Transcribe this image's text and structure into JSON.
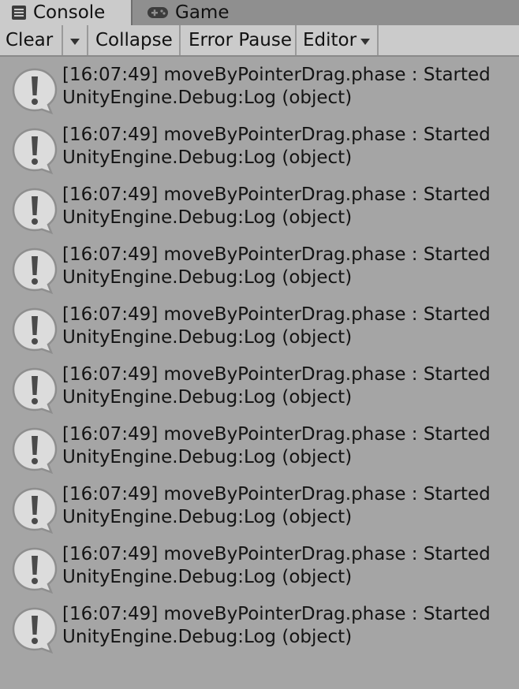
{
  "tabs": [
    {
      "label": "Console",
      "icon": "console-icon",
      "active": true
    },
    {
      "label": "Game",
      "icon": "gamepad-icon",
      "active": false
    }
  ],
  "toolbar": {
    "clear_label": "Clear",
    "clear_dropdown_icon": "chevron-down-icon",
    "collapse_label": "Collapse",
    "error_pause_label": "Error Pause",
    "editor_label": "Editor",
    "editor_dropdown_icon": "chevron-down-icon"
  },
  "logs": [
    {
      "icon": "info-message-icon",
      "message": "[16:07:49] moveByPointerDrag.phase : Started",
      "source": "UnityEngine.Debug:Log (object)"
    },
    {
      "icon": "info-message-icon",
      "message": "[16:07:49] moveByPointerDrag.phase : Started",
      "source": "UnityEngine.Debug:Log (object)"
    },
    {
      "icon": "info-message-icon",
      "message": "[16:07:49] moveByPointerDrag.phase : Started",
      "source": "UnityEngine.Debug:Log (object)"
    },
    {
      "icon": "info-message-icon",
      "message": "[16:07:49] moveByPointerDrag.phase : Started",
      "source": "UnityEngine.Debug:Log (object)"
    },
    {
      "icon": "info-message-icon",
      "message": "[16:07:49] moveByPointerDrag.phase : Started",
      "source": "UnityEngine.Debug:Log (object)"
    },
    {
      "icon": "info-message-icon",
      "message": "[16:07:49] moveByPointerDrag.phase : Started",
      "source": "UnityEngine.Debug:Log (object)"
    },
    {
      "icon": "info-message-icon",
      "message": "[16:07:49] moveByPointerDrag.phase : Started",
      "source": "UnityEngine.Debug:Log (object)"
    },
    {
      "icon": "info-message-icon",
      "message": "[16:07:49] moveByPointerDrag.phase : Started",
      "source": "UnityEngine.Debug:Log (object)"
    },
    {
      "icon": "info-message-icon",
      "message": "[16:07:49] moveByPointerDrag.phase : Started",
      "source": "UnityEngine.Debug:Log (object)"
    },
    {
      "icon": "info-message-icon",
      "message": "[16:07:49] moveByPointerDrag.phase : Started",
      "source": "UnityEngine.Debug:Log (object)"
    }
  ],
  "colors": {
    "background": "#a5a5a5",
    "toolbar": "#cbcbcb",
    "tabbar": "#8f8f8f",
    "text": "#111111"
  }
}
